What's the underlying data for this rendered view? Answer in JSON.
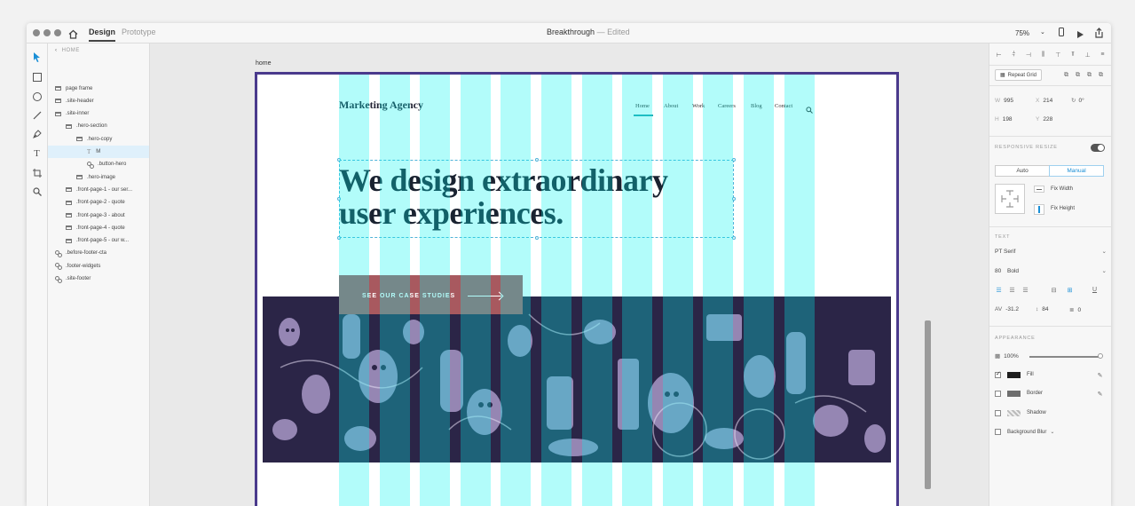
{
  "app": {
    "tabs": [
      "Design",
      "Prototype"
    ],
    "document_title": "Breakthrough",
    "document_status": "Edited",
    "title_separator": "—",
    "zoom": "75%"
  },
  "layers": {
    "back_label": "HOME",
    "items": [
      {
        "label": "page frame",
        "type": "folder",
        "indent": 0
      },
      {
        "label": ".site-header",
        "type": "folder",
        "indent": 0
      },
      {
        "label": ".site-inner",
        "type": "folder",
        "indent": 0
      },
      {
        "label": ".hero-section",
        "type": "folder",
        "indent": 1
      },
      {
        "label": ".hero-copy",
        "type": "folder",
        "indent": 2
      },
      {
        "label": "M",
        "type": "text",
        "indent": 3
      },
      {
        "label": ".button-hero",
        "type": "component",
        "indent": 3
      },
      {
        "label": ".hero-image",
        "type": "folder",
        "indent": 2
      },
      {
        "label": ".front-page-1 - our ser...",
        "type": "folder",
        "indent": 1
      },
      {
        "label": ".front-page-2 - quote",
        "type": "folder",
        "indent": 1
      },
      {
        "label": ".front-page-3 - about",
        "type": "folder",
        "indent": 1
      },
      {
        "label": ".front-page-4 - quote",
        "type": "folder",
        "indent": 1
      },
      {
        "label": ".front-page-5 - our w...",
        "type": "folder",
        "indent": 1
      },
      {
        "label": ".before-footer-cta",
        "type": "component",
        "indent": 0
      },
      {
        "label": ".footer-widgets",
        "type": "component",
        "indent": 0
      },
      {
        "label": ".site-footer",
        "type": "component",
        "indent": 0
      }
    ]
  },
  "artboard": {
    "name": "home",
    "brand": "Marketing Agency",
    "nav": [
      "Home",
      "About",
      "Work",
      "Careers",
      "Blog",
      "Contact"
    ],
    "headline_line1": "We design extraordinary",
    "headline_line2": "user experiences.",
    "cta_label": "SEE OUR CASE STUDIES",
    "grid_column_count": 12
  },
  "inspector": {
    "repeat_grid": "Repeat Grid",
    "w_label": "W",
    "w_value": "995",
    "x_label": "X",
    "x_value": "214",
    "rotation": "0°",
    "h_label": "H",
    "h_value": "198",
    "y_label": "Y",
    "y_value": "228",
    "responsive_resize": "RESPONSIVE RESIZE",
    "auto": "Auto",
    "manual": "Manual",
    "fix_width": "Fix Width",
    "fix_height": "Fix Height",
    "text_section": "TEXT",
    "font_family": "PT Serif",
    "font_size": "80",
    "font_weight": "Bold",
    "char_spacing": "-31.2",
    "line_spacing": "84",
    "para_spacing": "0",
    "appearance": "APPEARANCE",
    "opacity": "100%",
    "opacity_level": 1.0,
    "fill": "Fill",
    "border": "Border",
    "shadow": "Shadow",
    "background_blur": "Background Blur",
    "fill_color": "#1e1e1e",
    "border_color": "#6e6e6e",
    "accent_color": "#1a8fd6"
  }
}
